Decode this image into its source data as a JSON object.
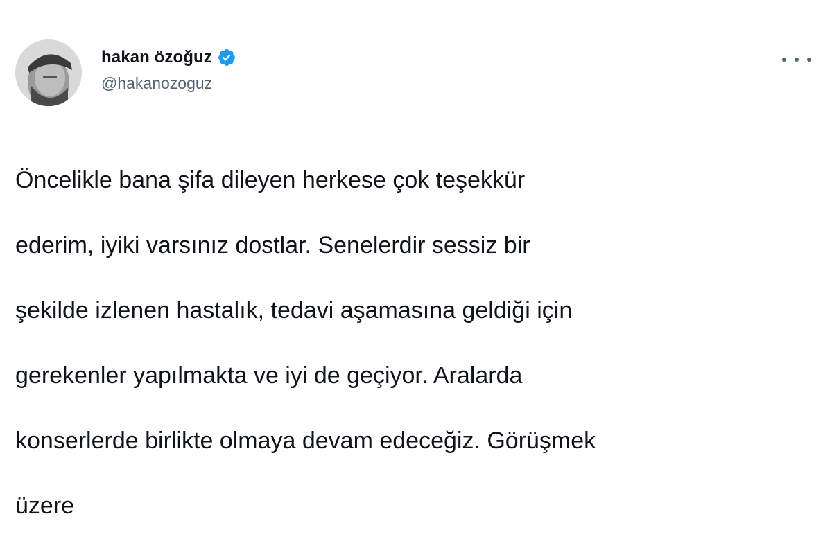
{
  "author": {
    "display_name": "hakan özoğuz",
    "handle": "@hakanozoguz",
    "verified": true,
    "verified_color": "#1d9bf0"
  },
  "menu": {
    "icon": "more-horizontal-icon"
  },
  "tweet": {
    "lines": [
      "Öncelikle bana şifa dileyen herkese çok teşekkür",
      "ederim, iyiki varsınız dostlar. Senelerdir sessiz bir",
      "şekilde izlenen hastalık, tedavi aşamasına geldiği için",
      "gerekenler yapılmakta ve iyi de geçiyor. Aralarda",
      "konserlerde birlikte olmaya devam edeceğiz. Görüşmek",
      "üzere"
    ]
  }
}
